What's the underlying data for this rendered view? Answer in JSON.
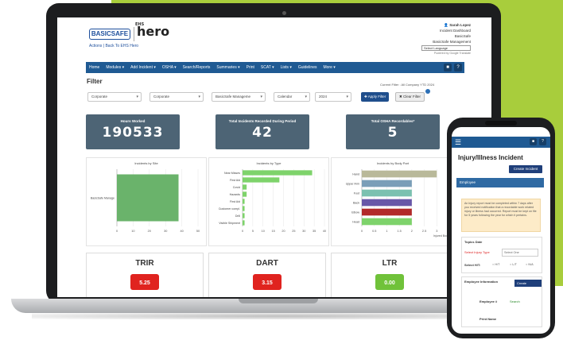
{
  "header": {
    "logo_basic": "BASICSAFE",
    "logo_hero_small": "EHS",
    "logo_hero": "hero",
    "breadcrumb": "Actions | Back To EHS Hero",
    "user_name": "Sarah Lopez",
    "links": [
      "Incident Dashboard",
      "BasicSafe",
      "BasicSafe Management"
    ],
    "language_select": "Select Language",
    "powered": "Powered by Google Translate"
  },
  "nav": {
    "items": [
      "Home",
      "Modules ▾",
      "Add Incident ▾",
      "OSHA ▾",
      "Search/Reports",
      "Summaries ▾",
      "Print",
      "SCAT ▾",
      "Lists ▾",
      "Guidelines",
      "More ▾"
    ]
  },
  "filter": {
    "title": "Filter",
    "current": "Current Filter : All Company YTD 2024",
    "selects": [
      "Corporate",
      "Corporate",
      "BasicSafe Manageme",
      "Calendar",
      "2024"
    ],
    "apply_label": "✚ Apply Filter",
    "clear_label": "✖ Clear Filter"
  },
  "kpis": [
    {
      "label": "Hours Worked",
      "value": "190533"
    },
    {
      "label": "Total Incidents Recorded During Period",
      "value": "42"
    },
    {
      "label": "Total OSHA Recordables*",
      "value": "5"
    }
  ],
  "charts": {
    "by_site": {
      "title": "Incidents by Site",
      "categories": [
        "BasicSafe Manage"
      ],
      "values": [
        38
      ],
      "ticks": [
        "0",
        "10",
        "20",
        "30",
        "40",
        "50"
      ],
      "xlim": [
        0,
        50
      ],
      "color": "#6ab36b"
    },
    "by_type": {
      "title": "Incidents by Type",
      "categories": [
        "Near Misses",
        "First Aid",
        "Covid",
        "Hazards",
        "First Aid",
        "Customer compl.",
        "Drill",
        "Visible Shipment"
      ],
      "values": [
        34,
        18,
        2,
        2,
        1,
        1,
        1,
        1
      ],
      "ticks": [
        "0",
        "5",
        "10",
        "15",
        "20",
        "25",
        "30",
        "35",
        "40"
      ],
      "xlim": [
        0,
        40
      ],
      "color": "#7ed36b"
    },
    "by_body_part": {
      "title": "Incidents by Body Part",
      "categories": [
        "Hand",
        "Upper Arm",
        "Foot",
        "Back",
        "Elbow",
        "Head"
      ],
      "values": [
        3,
        2,
        2,
        2,
        2,
        2
      ],
      "colors": [
        "#b9b99a",
        "#7a9eb8",
        "#7bc1b0",
        "#6857a8",
        "#b22a2a",
        "#7ed36b"
      ],
      "ticks": [
        "0",
        "0.5",
        "1",
        "1.5",
        "2",
        "2.5",
        "3",
        "3.5"
      ],
      "xlim": [
        0,
        3.5
      ],
      "xlabel": "Injured Body"
    }
  },
  "metrics": [
    {
      "title": "TRIR",
      "value": "5.25",
      "color": "#e0231f"
    },
    {
      "title": "DART",
      "value": "3.15",
      "color": "#e0231f"
    },
    {
      "title": "LTR",
      "value": "0.00",
      "color": "#70c23a"
    }
  ],
  "phone": {
    "title": "Injury/Illness Incident",
    "create_label": "Create Incident",
    "employee_section": "Employee",
    "notice": "An Injury report must be completed within 7 days after you received notification that a recordable work related injury or illness had occurred. Report must be kept on file for 5 years following the year for which it pertains.",
    "topic_label": "Topics Date",
    "injury_type_label": "Select Injury Type",
    "injury_type_value": "Select One",
    "select_ht_label": "Select H/T:",
    "radio_options": [
      "H/T",
      "L/T",
      "N/A"
    ],
    "employee_info_label": "Employee Information",
    "create_employee": "Create Employee",
    "employee_id_label": "Employee #",
    "search_label": "Search",
    "print_name_label": "Print Name"
  }
}
